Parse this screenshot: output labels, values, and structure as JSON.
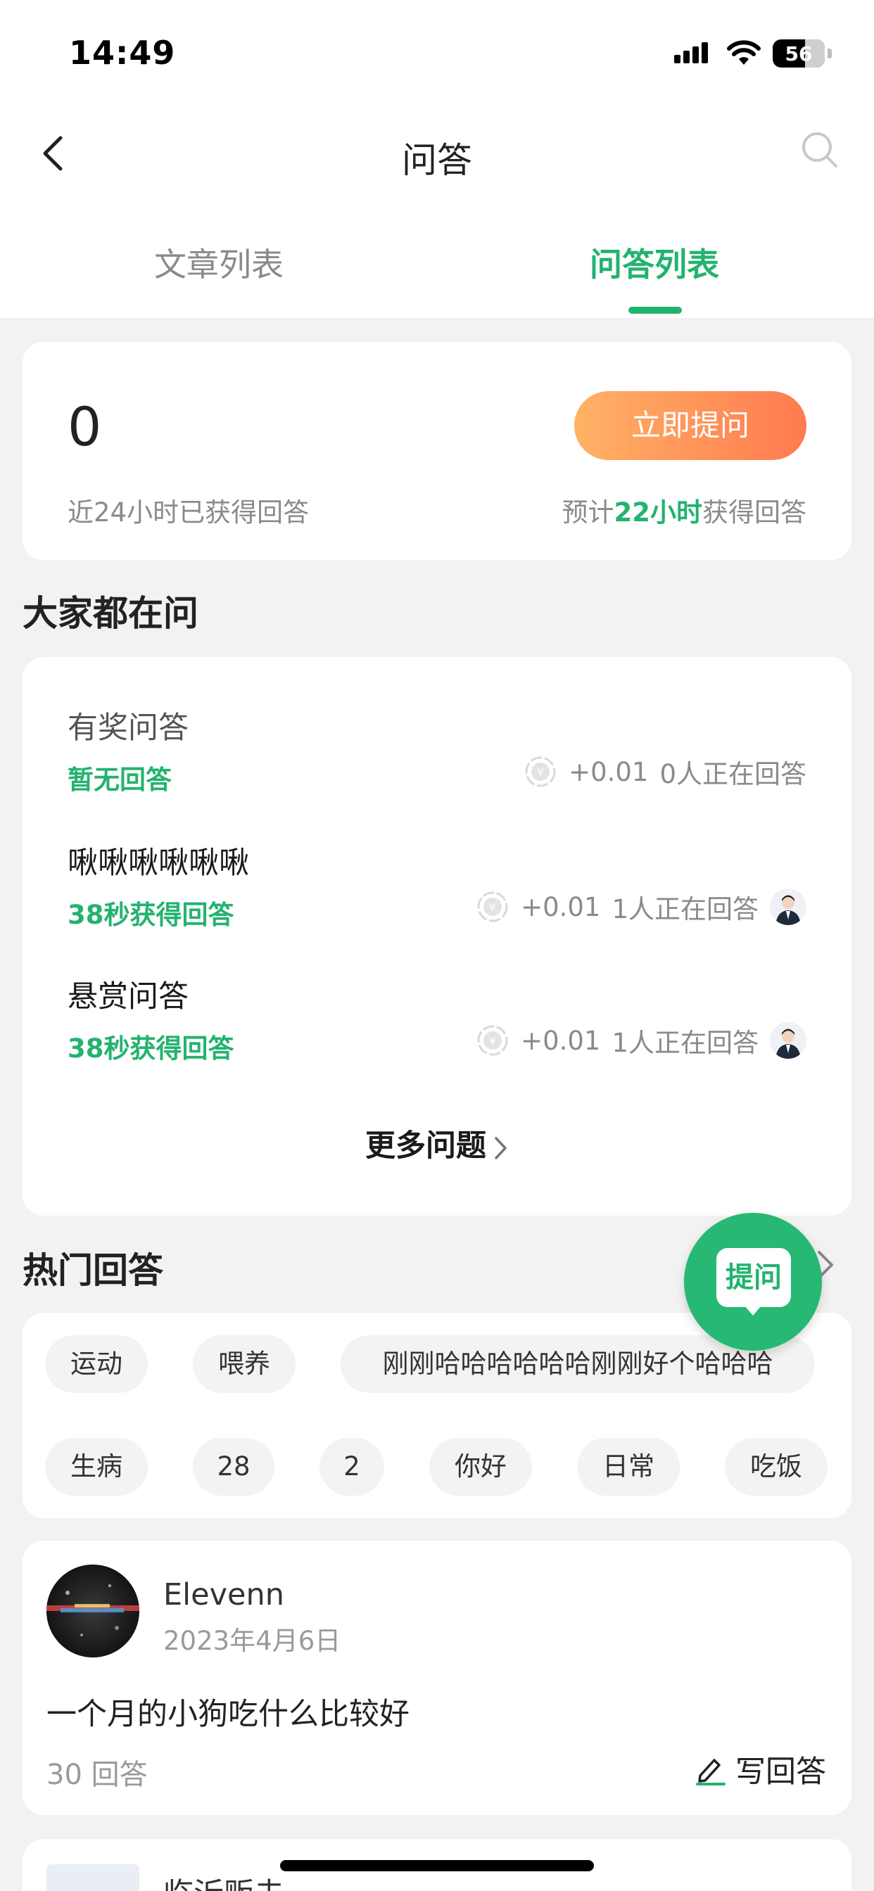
{
  "status_bar": {
    "time": "14:49",
    "battery": "56"
  },
  "nav": {
    "title": "问答"
  },
  "tabs": [
    {
      "label": "文章列表",
      "active": false
    },
    {
      "label": "问答列表",
      "active": true
    }
  ],
  "stats": {
    "count": "0",
    "count_label": "近24小时已获得回答",
    "ask_button": "立即提问",
    "estimate_prefix": "预计",
    "estimate_highlight": "22小时",
    "estimate_suffix": "获得回答"
  },
  "asking": {
    "title": "大家都在问",
    "questions": [
      {
        "title": "有奖问答",
        "status": "暂无回答",
        "reward": "+0.01",
        "answering": "0人正在回答",
        "has_avatar": false
      },
      {
        "title": "啾啾啾啾啾啾",
        "status": "38秒获得回答",
        "reward": "+0.01",
        "answering": "1人正在回答",
        "has_avatar": true
      },
      {
        "title": "悬赏问答",
        "status": "38秒获得回答",
        "reward": "+0.01",
        "answering": "1人正在回答",
        "has_avatar": true
      }
    ],
    "more": "更多问题"
  },
  "hot": {
    "title": "热门回答",
    "tags": [
      "运动",
      "喂养",
      "刚刚哈哈哈哈哈哈刚刚好个哈哈哈",
      "生病",
      "28",
      "2",
      "你好",
      "日常",
      "吃饭"
    ]
  },
  "post": {
    "author": "Elevenn",
    "date": "2023年4月6日",
    "question": "一个月的小狗吃什么比较好",
    "answers": "30 回答",
    "write_answer": "写回答"
  },
  "next_post": {
    "author": "临沂贩夫"
  },
  "fab": {
    "label": "提问"
  },
  "colors": {
    "accent": "#23b36f",
    "button_gradient_start": "#ffb266",
    "button_gradient_end": "#ff7a4f"
  }
}
